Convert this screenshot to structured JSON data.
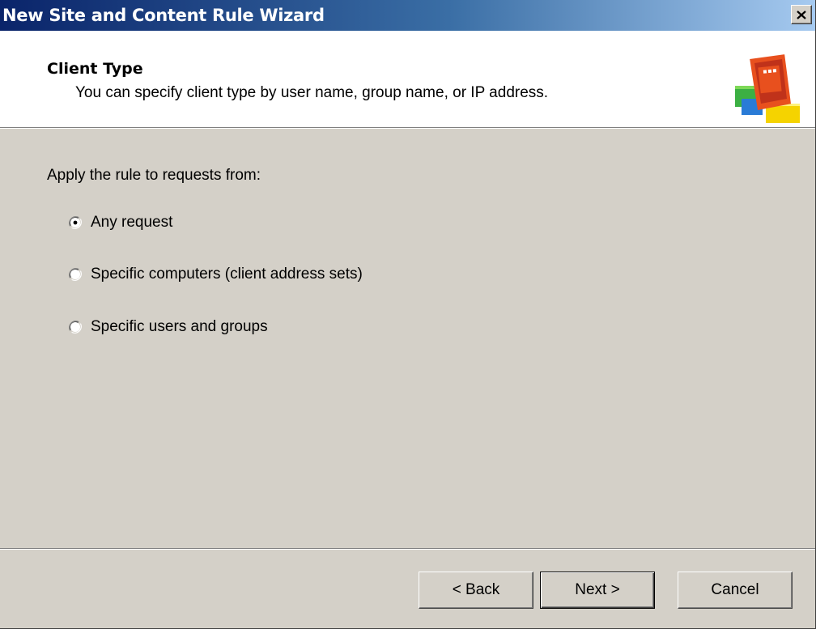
{
  "window": {
    "title": "New Site and Content Rule Wizard",
    "close_symbol": "✕"
  },
  "header": {
    "title": "Client Type",
    "subtitle": "You can specify client type by user name, group name, or IP address.",
    "icon": "wizard-rule-icon"
  },
  "body": {
    "prompt": "Apply the rule to requests from:",
    "options": [
      {
        "label": "Any request",
        "selected": true
      },
      {
        "label": "Specific computers (client address sets)",
        "selected": false
      },
      {
        "label": "Specific users and groups",
        "selected": false
      }
    ]
  },
  "buttons": {
    "back": "< Back",
    "next": "Next >",
    "cancel": "Cancel"
  },
  "colors": {
    "titlebar_start": "#0a246a",
    "titlebar_end": "#a6caf0",
    "dialog_bg": "#d4d0c8",
    "header_bg": "#ffffff"
  }
}
